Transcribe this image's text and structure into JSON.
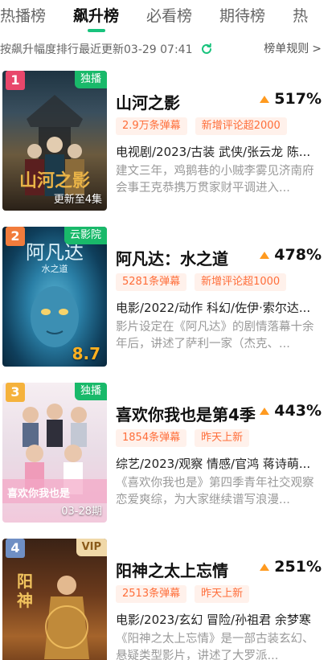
{
  "tabs": [
    {
      "label": "热播榜",
      "active": false
    },
    {
      "label": "飙升榜",
      "active": true
    },
    {
      "label": "必看榜",
      "active": false
    },
    {
      "label": "期待榜",
      "active": false
    },
    {
      "label": "热",
      "active": false
    }
  ],
  "subbar": {
    "updated": "按飙升幅度排行最近更新03-29 07:41",
    "rules": "榜单规则",
    "icons": {
      "refresh": "refresh-icon",
      "chevron": "chevron-right-icon"
    }
  },
  "colors": {
    "accent": "#18c37d",
    "tag_text": "#ff6e3a",
    "tag_bg": "#fff1eb",
    "up_arrow": "#ff9a1f"
  },
  "items": [
    {
      "rank": "1",
      "rank_color": "#e8476b",
      "platform": "独播",
      "platform_style": "green",
      "poster_overlay": "更新至4集",
      "poster_score": "",
      "title": "山河之影",
      "growth": "517%",
      "tags": [
        "2.9万条弹幕",
        "新增评论超2000"
      ],
      "meta": "电视剧/2023/古装 武侠/张云龙 陈...",
      "desc": "建文三年，鸡鹅巷的小贼李雾见济南府会事王克恭携万贯家财平调进入..."
    },
    {
      "rank": "2",
      "rank_color": "#f27c3c",
      "platform": "云影院",
      "platform_style": "green",
      "poster_overlay": "",
      "poster_score": "8.7",
      "title": "阿凡达：水之道",
      "growth": "478%",
      "tags": [
        "5281条弹幕",
        "新增评论超1000"
      ],
      "meta": "电影/2022/动作 科幻/佐伊·索尔达...",
      "desc": "影片设定在《阿凡达》的剧情落幕十余年后，讲述了萨利一家（杰克、..."
    },
    {
      "rank": "3",
      "rank_color": "#f5b23c",
      "platform": "独播",
      "platform_style": "green",
      "poster_overlay": "03-28期",
      "poster_score": "",
      "title": "喜欢你我也是第4季",
      "growth": "443%",
      "tags": [
        "1854条弹幕",
        "昨天上新"
      ],
      "meta": "综艺/2023/观察 情感/官鸿 蒋诗萌...",
      "desc": "《喜欢你我也是》第四季青年社交观察恋爱爽综，为大家继续谱写浪漫..."
    },
    {
      "rank": "4",
      "rank_color": "#6f8fc4",
      "platform": "VIP",
      "platform_style": "vip",
      "poster_overlay": "",
      "poster_score": "",
      "title": "阳神之太上忘情",
      "growth": "251%",
      "tags": [
        "2513条弹幕",
        "昨天上新"
      ],
      "meta": "电影/2023/玄幻 冒险/孙祖君 余梦寒",
      "desc": "《阳神之太上忘情》是一部古装玄幻、悬疑类型影片，讲述了大罗派..."
    }
  ]
}
